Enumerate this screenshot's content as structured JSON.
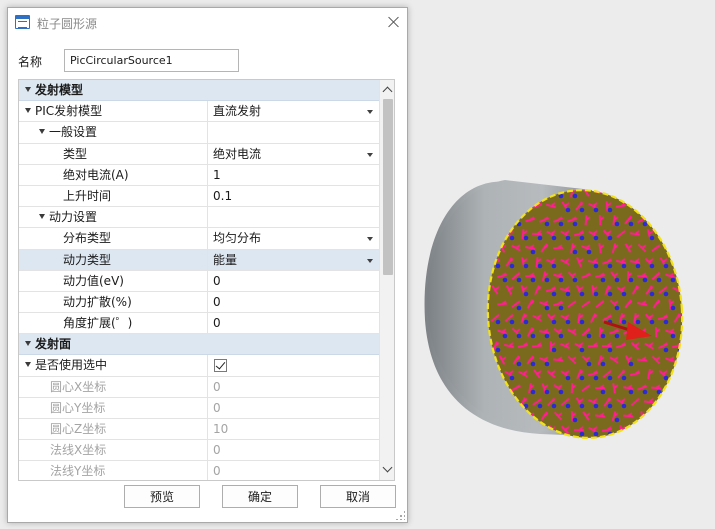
{
  "dialog": {
    "title": "粒子圆形源",
    "name_label": "名称",
    "name_value": "PicCircularSource1"
  },
  "grid": {
    "rows": [
      {
        "kind": "category",
        "label": "发射模型"
      },
      {
        "kind": "prop",
        "label": "PIC发射模型",
        "value": "直流发射",
        "dropdown": true,
        "expander": false
      },
      {
        "kind": "group",
        "label": "一般设置",
        "value": ""
      },
      {
        "kind": "prop",
        "label": "类型",
        "value": "绝对电流",
        "dropdown": true
      },
      {
        "kind": "prop",
        "label": "绝对电流(A)",
        "value": "1"
      },
      {
        "kind": "prop",
        "label": "上升时间",
        "value": "0.1"
      },
      {
        "kind": "group",
        "label": "动力设置",
        "value": ""
      },
      {
        "kind": "prop",
        "label": "分布类型",
        "value": "均匀分布",
        "dropdown": true
      },
      {
        "kind": "prop",
        "label": "动力类型",
        "value": "能量",
        "dropdown": true,
        "selected": true
      },
      {
        "kind": "prop",
        "label": "动力值(eV)",
        "value": "0"
      },
      {
        "kind": "prop",
        "label": "动力扩散(%)",
        "value": "0"
      },
      {
        "kind": "prop",
        "label": "角度扩展(゜)",
        "value": "0"
      },
      {
        "kind": "category",
        "label": "发射面"
      },
      {
        "kind": "check",
        "label": "是否使用选中",
        "checked": true
      },
      {
        "kind": "prop",
        "label": "圆心X坐标",
        "value": "0",
        "disabled": true
      },
      {
        "kind": "prop",
        "label": "圆心Y坐标",
        "value": "0",
        "disabled": true
      },
      {
        "kind": "prop",
        "label": "圆心Z坐标",
        "value": "10",
        "disabled": true
      },
      {
        "kind": "prop",
        "label": "法线X坐标",
        "value": "0",
        "disabled": true
      },
      {
        "kind": "prop",
        "label": "法线Y坐标",
        "value": "0",
        "disabled": true
      }
    ]
  },
  "buttons": {
    "preview": "预览",
    "ok": "确定",
    "cancel": "取消"
  },
  "colors": {
    "category_bg": "#dde7f2",
    "emitter_face": "#7a6a1e",
    "emitter_rim": "#f2e21a",
    "particle_pink": "#ff1f8e",
    "particle_blue": "#2a2ad8",
    "cylinder_body": "#9aa0a4",
    "normal_arrow": "#e0201a"
  }
}
